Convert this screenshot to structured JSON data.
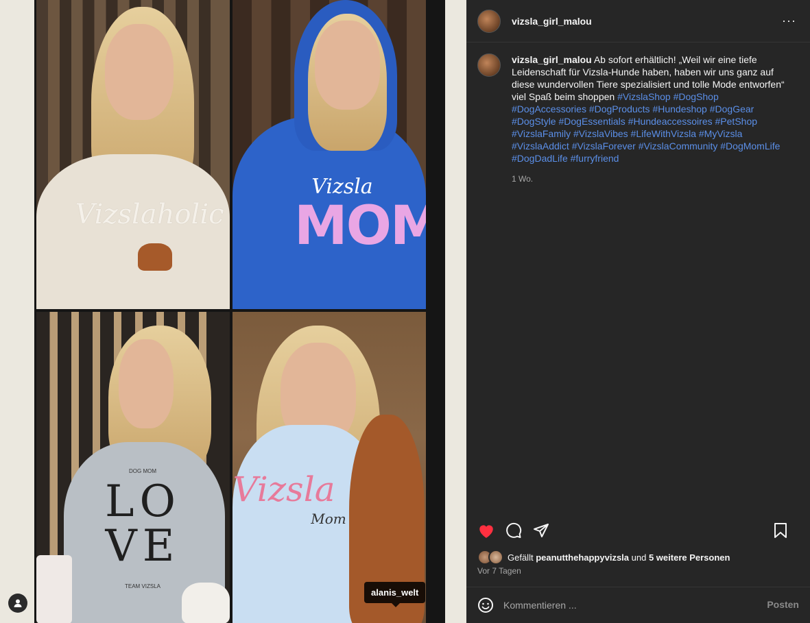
{
  "post": {
    "username": "vizsla_girl_malou",
    "caption_text": "Ab sofort erhältlich! „Weil wir eine tiefe Leidenschaft für Vizsla-Hunde haben, haben wir uns ganz auf diese wundervollen Tiere spezialisiert und tolle Mode entworfen“ viel Spaß beim shoppen",
    "hashtags": [
      "#VizslaShop",
      "#DogShop",
      "#DogAccessories",
      "#DogProducts",
      "#Hundeshop",
      "#DogGear",
      "#DogStyle",
      "#DogEssentials",
      "#Hundeaccessoires",
      "#PetShop",
      "#VizslaFamily",
      "#VizslaVibes",
      "#LifeWithVizsla",
      "#MyVizsla",
      "#VizslaAddict",
      "#VizslaForever",
      "#VizslaCommunity",
      "#DogMomLife",
      "#DogDadLife",
      "#furryfriend"
    ],
    "caption_time": "1 Wo.",
    "likes_prefix": "Gefällt",
    "likes_user": "peanutthehappyvizsla",
    "likes_join": "und",
    "likes_others": "5 weitere Personen",
    "posted_ago": "Vor 7 Tagen",
    "comment_placeholder": "Kommentieren ...",
    "post_button": "Posten",
    "more_label": "···"
  },
  "media": {
    "tagged_user": "alanis_welt",
    "shirt_texts": {
      "t1": "Vizslaholic",
      "t2_script": "Vizsla",
      "t2_big": "MOM",
      "t3_small": "DOG MOM",
      "t3_big1": "LO",
      "t3_big2": "VE",
      "t3_bottom": "TEAM VIZSLA",
      "t4_script": "Vizsla",
      "t4_sub": "Mom"
    }
  },
  "colors": {
    "accent_link": "#5b8fe8",
    "like_red": "#ff3040",
    "panel_bg": "#262626"
  }
}
